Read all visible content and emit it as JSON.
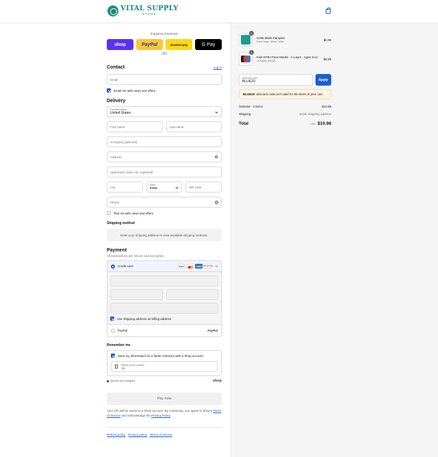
{
  "brand": {
    "name": "VITAL SUPPLY",
    "sub": "STORE"
  },
  "express": {
    "label": "Express checkout",
    "shop": "shop",
    "paypal": "PayPal",
    "amazon": "amazon pay",
    "gpay": "G Pay",
    "or": "OR"
  },
  "contact": {
    "title": "Contact",
    "login": "Log in",
    "email_placeholder": "Email",
    "email_opt": "Email me with news and offers"
  },
  "delivery": {
    "title": "Delivery",
    "country_label": "Country/Region",
    "country_value": "United States",
    "first_name": "First name",
    "last_name": "Last name",
    "company": "Company (optional)",
    "address": "Address",
    "apartment": "Apartment, suite, etc. (optional)",
    "city": "City",
    "state_label": "State",
    "state_value": "Iowa",
    "zip": "ZIP code",
    "phone": "Phone",
    "text_opt": "Text me with news and offers"
  },
  "shipping": {
    "title": "Shipping method",
    "message": "Enter your shipping address to view available shipping methods."
  },
  "payment": {
    "title": "Payment",
    "note": "All transactions are secure and encrypted.",
    "credit_card": "Credit card",
    "cards": {
      "visa": "VISA",
      "amex": "AMEX",
      "discover": "DISCOVER",
      "more": "+5"
    },
    "billing_opt": "Use shipping address as billing address",
    "paypal": "PayPal",
    "paypal_logo": "PayPal"
  },
  "remember": {
    "title": "Remember me",
    "save_opt": "Save my information for a faster checkout with a Shop account",
    "phone_label": "Mobile phone number",
    "phone_value": "+1",
    "secure": "Secured and encrypted",
    "shop": "shop"
  },
  "paynow": "Pay now",
  "disclaimer": {
    "prefix": "Your info will be saved to a Shop account. By continuing, you agree to Shop's",
    "terms": "Terms of Service",
    "mid": "and acknowledge the",
    "privacy": "Privacy Policy",
    "end": "."
  },
  "footer": {
    "refund": "Refund policy",
    "privacy": "Privacy policy",
    "terms": "Terms of service"
  },
  "summary": {
    "items": [
      {
        "qty": "1",
        "name": "Kn95 Mask Samples",
        "variant": "Extra Large / Black / With",
        "price": "$0.99"
      },
      {
        "qty": "1",
        "name": "Kids KF94 Face Masks - 4 Layer - Ages 5-11",
        "variant": "10 Masks (White)",
        "price": "$9.99"
      }
    ],
    "discount_label": "Discount code",
    "discount_value": "BLUE20",
    "apply": "Apply",
    "warning_code": "BLUE20",
    "warning_text": "discount code isn't valid for the items in your cart",
    "subtotal_label": "Subtotal · 2 items",
    "subtotal_value": "$10.98",
    "shipping_label": "Shipping",
    "shipping_value": "Enter shipping address",
    "total_label": "Total",
    "total_currency": "USD",
    "total_value": "$10.98"
  },
  "colors": {
    "accent": "#1a5fd0",
    "brand": "#1f8c7a",
    "shop": "#5a31f4",
    "paypal": "#ffc439",
    "amazon": "#ffd814"
  }
}
